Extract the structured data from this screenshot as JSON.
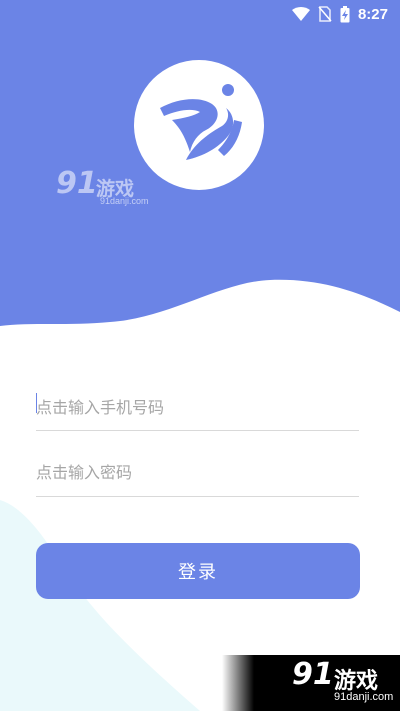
{
  "status_bar": {
    "time": "8:27",
    "icons": [
      "wifi-icon",
      "no-sim-icon",
      "battery-charging-icon"
    ]
  },
  "app": {
    "logo_icon": "app-logo-icon",
    "colors": {
      "primary": "#6b84e6",
      "field_border": "#d9d9d9",
      "placeholder": "#a6a6a6",
      "decor": "#eaf9fb"
    }
  },
  "login": {
    "phone_placeholder": "点击输入手机号码",
    "password_placeholder": "点击输入密码",
    "login_button": "登录"
  },
  "watermark": {
    "number": "91",
    "name": "游戏",
    "domain": "91danji.com"
  }
}
